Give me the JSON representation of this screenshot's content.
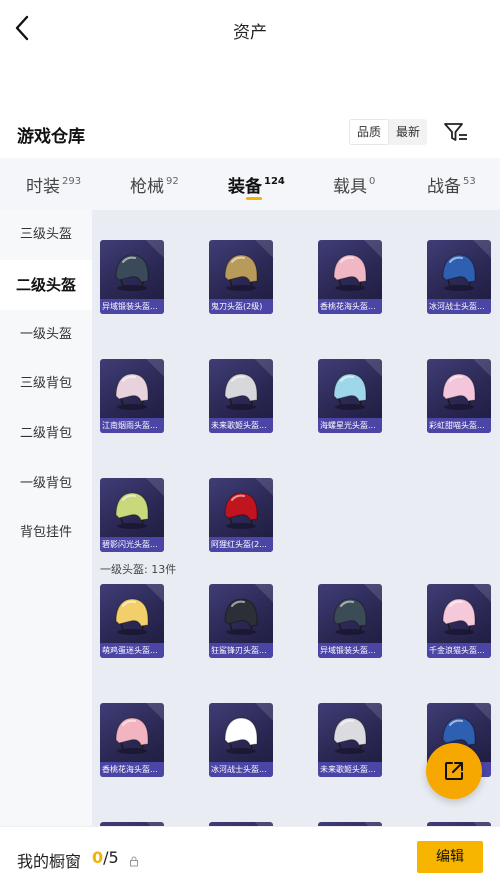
{
  "nav": {
    "title": "资产"
  },
  "section": {
    "title": "游戏仓库",
    "sort_options": [
      "品质",
      "最新"
    ],
    "active_sort": "品质"
  },
  "tabs": [
    {
      "label": "时装",
      "count": "293"
    },
    {
      "label": "枪械",
      "count": "92"
    },
    {
      "label": "装备",
      "count": "124",
      "active": true
    },
    {
      "label": "载具",
      "count": "0"
    },
    {
      "label": "战备",
      "count": "53"
    }
  ],
  "sidebar": {
    "items": [
      "三级头盔",
      "二级头盔",
      "一级头盔",
      "三级背包",
      "二级背包",
      "一级背包",
      "背包挂件"
    ],
    "active": "二级头盔"
  },
  "groups": [
    {
      "name": "二级头盔",
      "items": [
        {
          "label": "异域锻装头盔...",
          "color": "#3a4a58"
        },
        {
          "label": "鬼刀头盔(2级)",
          "color": "#b89a5a"
        },
        {
          "label": "香桃花海头盔...",
          "color": "#f0b8c4"
        },
        {
          "label": "冰河战士头盔...",
          "color": "#2f5fb0"
        },
        {
          "label": "江南烟雨头盔...",
          "color": "#e8d2dc"
        },
        {
          "label": "未来歌姬头盔...",
          "color": "#d8d8dc"
        },
        {
          "label": "海螺星光头盔...",
          "color": "#9ed6ea"
        },
        {
          "label": "彩虹甜喵头盔...",
          "color": "#f3c6dc"
        },
        {
          "label": "碧影闪光头盔...",
          "color": "#c8d87a"
        },
        {
          "label": "阿狸红头盔(2...",
          "color": "#c0141e"
        }
      ]
    },
    {
      "name": "一级头盔",
      "header": "一级头盔: 13件",
      "items": [
        {
          "label": "萌鸡蛋迷头盔...",
          "color": "#f2cf6a"
        },
        {
          "label": "狂鲨锋刃头盔...",
          "color": "#2c2f38"
        },
        {
          "label": "异域锻装头盔...",
          "color": "#3b4c56"
        },
        {
          "label": "千金浪猫头盔...",
          "color": "#f6c9da"
        },
        {
          "label": "香桃花海头盔...",
          "color": "#f2b4c0"
        },
        {
          "label": "冰河战士头盔...",
          "color": "#ffffff"
        },
        {
          "label": "未来歌姬头盔...",
          "color": "#dcdce0"
        },
        {
          "label": "",
          "color": "#2f5fb0"
        },
        {
          "label": "",
          "color": "#444"
        },
        {
          "label": "",
          "color": "#444"
        },
        {
          "label": "",
          "color": "#444"
        },
        {
          "label": "",
          "color": "#444"
        }
      ]
    }
  ],
  "bottom": {
    "showcase_label": "我的橱窗",
    "used": "0",
    "total": "/5",
    "edit_label": "编辑"
  },
  "accent_color": "#f7b500"
}
